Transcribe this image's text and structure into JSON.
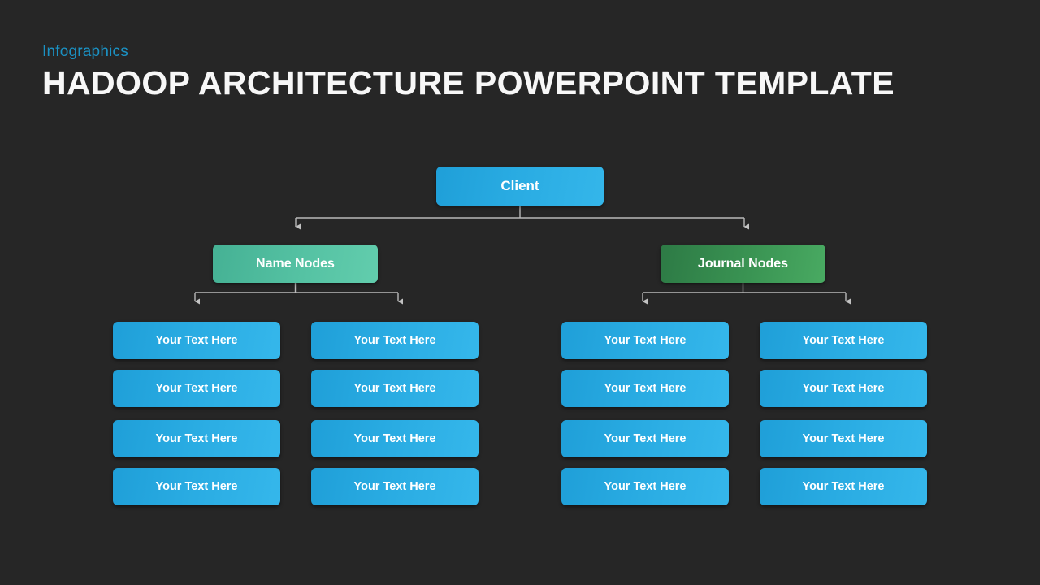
{
  "header": {
    "kicker": "Infographics",
    "title": "HADOOP ARCHITECTURE POWERPOINT TEMPLATE"
  },
  "colors": {
    "background": "#262626",
    "kicker": "#1b92c4",
    "title": "#f7f7f7",
    "client_blue": "#29abe2",
    "name_nodes_teal": "#55c2a3",
    "journal_nodes_green": "#3a9453",
    "leaf_blue": "#29abe2",
    "connector": "#b9b9b9"
  },
  "diagram": {
    "type": "hierarchy-tree",
    "root": {
      "label": "Client"
    },
    "branches": [
      {
        "label": "Name Nodes",
        "columns": [
          {
            "items": [
              {
                "label": "Your Text Here"
              },
              {
                "label": "Your Text Here"
              },
              {
                "label": "Your Text Here"
              },
              {
                "label": "Your Text Here"
              }
            ]
          },
          {
            "items": [
              {
                "label": "Your Text Here"
              },
              {
                "label": "Your Text Here"
              },
              {
                "label": "Your Text Here"
              },
              {
                "label": "Your Text Here"
              }
            ]
          }
        ]
      },
      {
        "label": "Journal Nodes",
        "columns": [
          {
            "items": [
              {
                "label": "Your Text Here"
              },
              {
                "label": "Your Text Here"
              },
              {
                "label": "Your Text Here"
              },
              {
                "label": "Your Text Here"
              }
            ]
          },
          {
            "items": [
              {
                "label": "Your Text Here"
              },
              {
                "label": "Your Text Here"
              },
              {
                "label": "Your Text Here"
              },
              {
                "label": "Your Text Here"
              }
            ]
          }
        ]
      }
    ]
  }
}
